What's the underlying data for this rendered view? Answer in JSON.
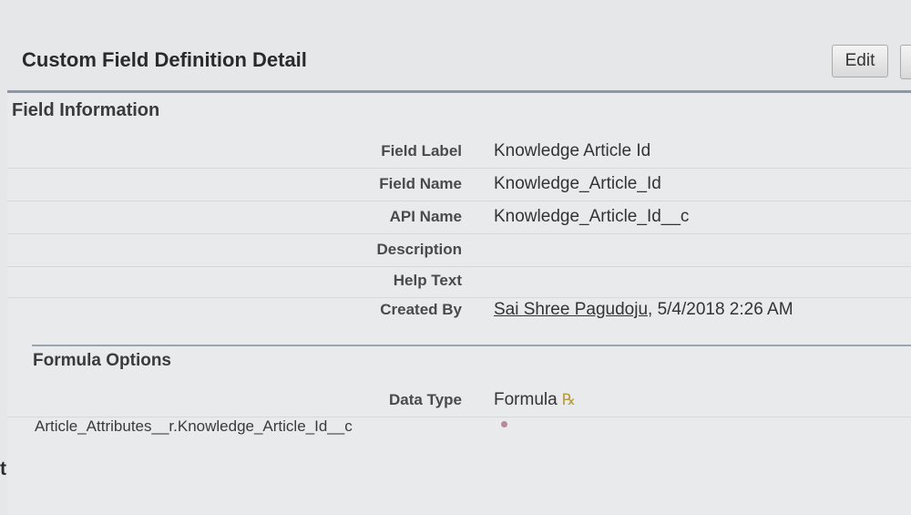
{
  "page": {
    "title": "Custom Field Definition Detail",
    "edit_label": "Edit"
  },
  "field_information": {
    "heading": "Field Information",
    "rows": [
      {
        "label": "Field Label",
        "value": "Knowledge Article Id"
      },
      {
        "label": "Field Name",
        "value": "Knowledge_Article_Id"
      },
      {
        "label": "API Name",
        "value": "Knowledge_Article_Id__c"
      },
      {
        "label": "Description",
        "value": ""
      },
      {
        "label": "Help Text",
        "value": ""
      },
      {
        "label": "Created By",
        "value_link": "Sai Shree Pagudoju",
        "value_suffix": ", 5/4/2018 2:26 AM"
      }
    ]
  },
  "formula_options": {
    "heading": "Formula Options",
    "data_type_label": "Data Type",
    "data_type_value": "Formula",
    "formula": "Article_Attributes__r.Knowledge_Article_Id__c"
  },
  "left_edge_fragment": "t",
  "icons": {
    "help": "help-icon"
  }
}
